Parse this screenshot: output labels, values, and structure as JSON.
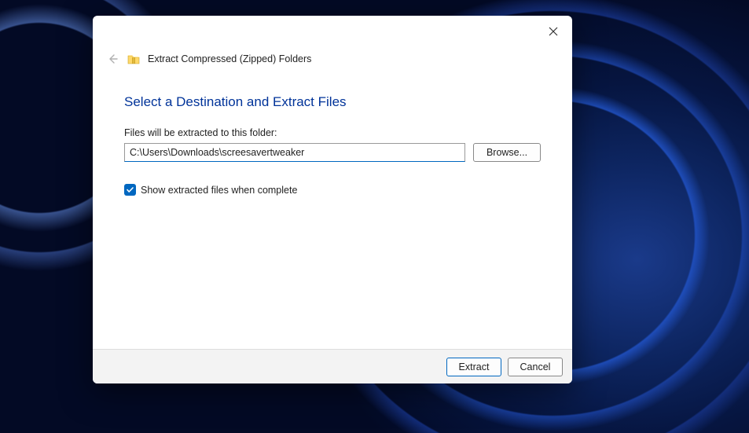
{
  "dialog": {
    "wizard_title": "Extract Compressed (Zipped) Folders",
    "heading": "Select a Destination and Extract Files",
    "field_label": "Files will be extracted to this folder:",
    "path_value": "C:\\Users\\Downloads\\screesavertweaker",
    "browse_label": "Browse...",
    "checkbox_label": "Show extracted files when complete",
    "checkbox_checked": true,
    "footer": {
      "extract_label": "Extract",
      "cancel_label": "Cancel"
    }
  }
}
